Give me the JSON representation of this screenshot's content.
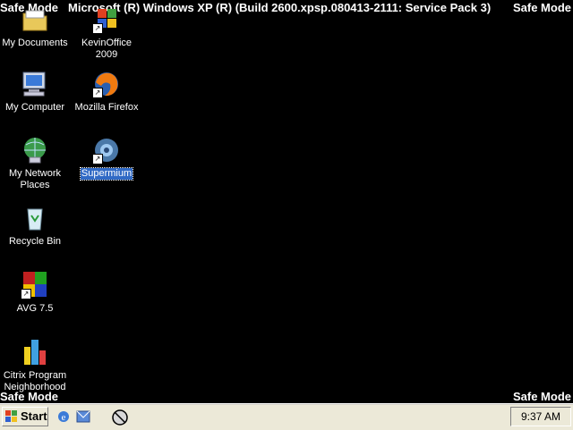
{
  "banner": {
    "safe_mode": "Safe Mode",
    "title": "Microsoft (R) Windows XP (R) (Build 2600.xpsp.080413-2111: Service Pack 3)"
  },
  "desktop_icons": [
    {
      "label": "My Documents",
      "icon": "folder-icon"
    },
    {
      "label": "KevinOffice 2009",
      "icon": "office-shortcut-icon"
    },
    {
      "label": "My Computer",
      "icon": "computer-icon"
    },
    {
      "label": "Mozilla Firefox",
      "icon": "firefox-icon"
    },
    {
      "label": "My Network Places",
      "icon": "network-icon"
    },
    {
      "label": "Supermium",
      "icon": "browser-icon",
      "selected": true
    },
    {
      "label": "Recycle Bin",
      "icon": "recycle-bin-icon"
    },
    {
      "label": "AVG 7.5",
      "icon": "avg-icon"
    },
    {
      "label": "Citrix Program Neighborhood",
      "icon": "citrix-icon"
    }
  ],
  "taskbar": {
    "start_label": "Start",
    "clock": "9:37 AM",
    "quick_launch": [
      "ie-icon",
      "outlook-express-icon",
      "media-icon"
    ]
  },
  "colors": {
    "desktop": "#000000",
    "taskbar": "#ece9d8",
    "selection": "#316ac5"
  }
}
